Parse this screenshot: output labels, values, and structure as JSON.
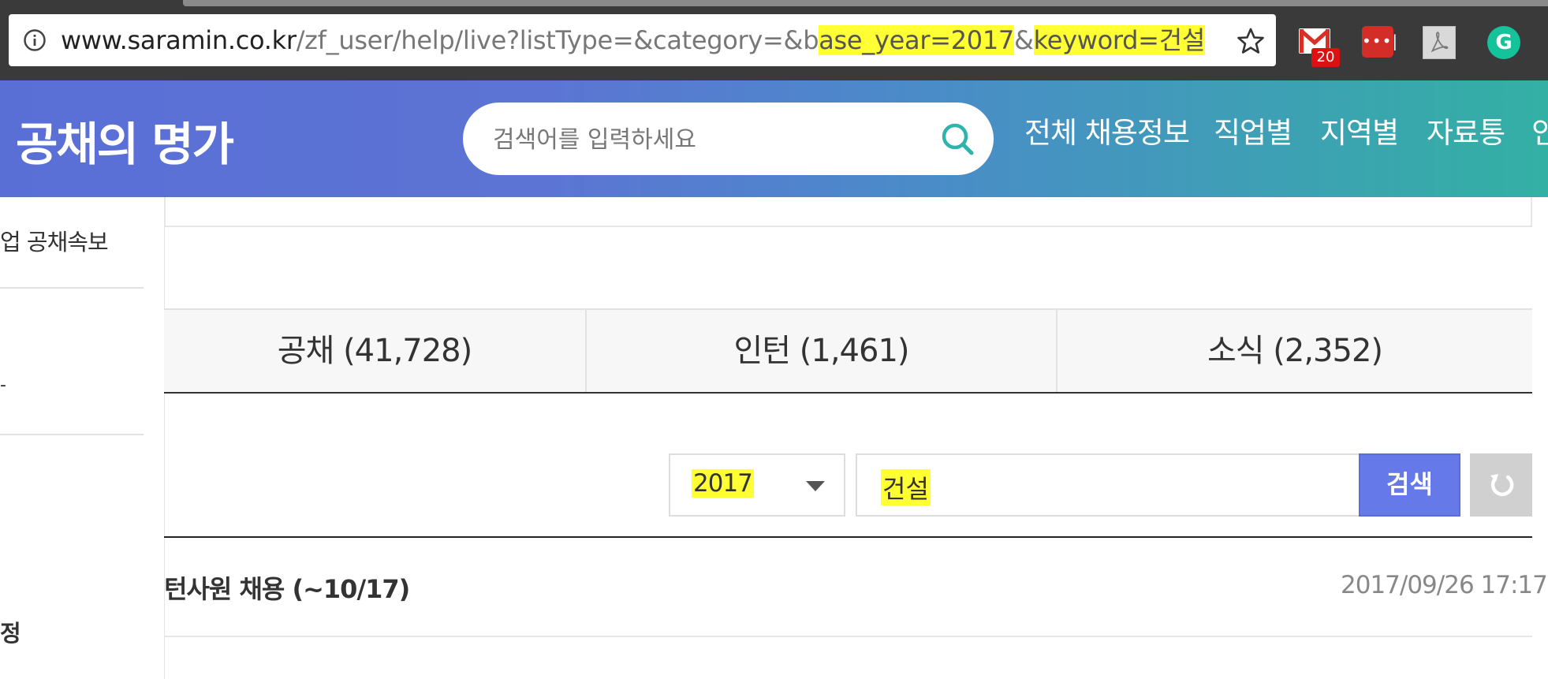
{
  "browser": {
    "url_host": "www.saramin.co.kr",
    "url_path": "/zf_user/help/live?listType=&category=&b",
    "url_hl1": "ase_year=2017",
    "url_mid": "&",
    "url_hl2": "keyword=건설",
    "extensions": {
      "gmail_badge": "20"
    }
  },
  "header": {
    "logo": "공채의 명가",
    "search_placeholder": "검색어를 입력하세요",
    "nav": [
      "전체 채용정보",
      "직업별",
      "지역별",
      "자료통",
      "인"
    ]
  },
  "sidebar": {
    "items": [
      "업 공채속보",
      "",
      "정"
    ]
  },
  "tabs": [
    {
      "label": "공채 (41,728)"
    },
    {
      "label": "인턴 (1,461)"
    },
    {
      "label": "소식 (2,352)"
    }
  ],
  "filter": {
    "year": "2017",
    "keyword": "건설",
    "search_button": "검색"
  },
  "list": [
    {
      "title": "턴사원 채용 (~10/17)",
      "date": "2017/09/26 17:17"
    },
    {
      "title": "",
      "date": ""
    }
  ],
  "colors": {
    "highlight": "#ffff33",
    "search_button": "#6679e9",
    "header_start": "#5a6fd6",
    "header_end": "#33b0a4"
  }
}
